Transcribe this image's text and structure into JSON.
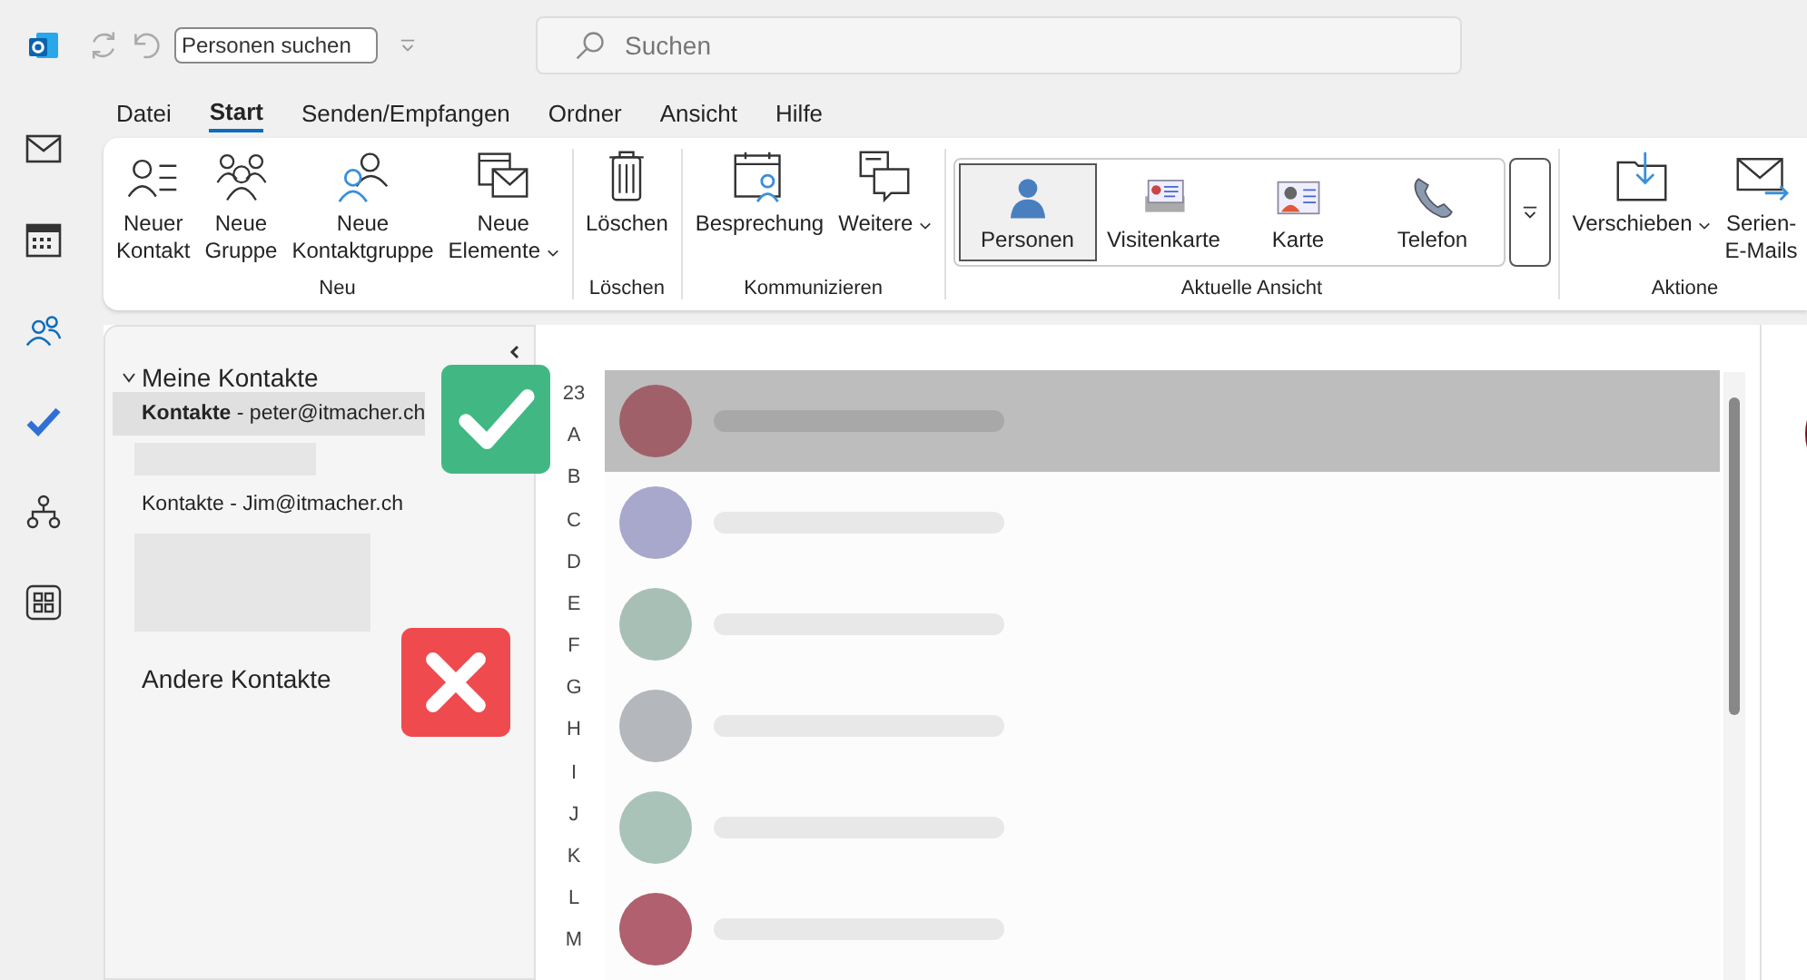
{
  "app_bar": {
    "people_search": "Personen suchen",
    "search": {
      "placeholder": "Suchen"
    }
  },
  "tabs": [
    {
      "label": "Datei",
      "selected": false
    },
    {
      "label": "Start",
      "selected": true
    },
    {
      "label": "Senden/Empfangen",
      "selected": false
    },
    {
      "label": "Ordner",
      "selected": false
    },
    {
      "label": "Ansicht",
      "selected": false
    },
    {
      "label": "Hilfe",
      "selected": false
    }
  ],
  "ribbon": {
    "groups": [
      {
        "label": "Neu",
        "buttons": [
          {
            "kind": "large",
            "label": "Neuer\nKontakt",
            "dropdown": false
          },
          {
            "kind": "large",
            "label": "Neue\nGruppe",
            "dropdown": false
          },
          {
            "kind": "large",
            "label": "Neue\nKontaktgruppe",
            "dropdown": false
          },
          {
            "kind": "large",
            "label": "Neue\nElemente",
            "dropdown": true
          }
        ]
      },
      {
        "label": "Löschen",
        "buttons": [
          {
            "kind": "large",
            "label": "Löschen",
            "dropdown": false
          }
        ]
      },
      {
        "label": "Kommunizieren",
        "buttons": [
          {
            "kind": "large",
            "label": "Besprechung",
            "dropdown": false
          },
          {
            "kind": "large",
            "label": "Weitere",
            "dropdown": true
          }
        ]
      },
      {
        "label": "Aktuelle Ansicht",
        "buttons": [
          {
            "kind": "view",
            "label": "Personen",
            "selected": true
          },
          {
            "kind": "view",
            "label": "Visitenkarte",
            "selected": false
          },
          {
            "kind": "view",
            "label": "Karte",
            "selected": false
          },
          {
            "kind": "view",
            "label": "Telefon",
            "selected": false
          },
          {
            "kind": "more"
          }
        ]
      },
      {
        "label": "Aktione",
        "buttons": [
          {
            "kind": "large",
            "label": "Verschieben",
            "dropdown": true
          },
          {
            "kind": "large",
            "label": "Serien-\nE-Mails",
            "dropdown": false
          }
        ]
      }
    ]
  },
  "folders": {
    "title": "Meine Kontakte",
    "expanded": true,
    "items": [
      {
        "kind": "account",
        "label": "**Kontakte** - peter@itmacher.ch",
        "selected": true
      },
      {
        "kind": "blurred"
      },
      {
        "kind": "account",
        "label": "Kontakte - Jim@itmacher.ch",
        "selected": false
      },
      {
        "kind": "blurred"
      }
    ],
    "other": "Andere Kontakte"
  },
  "contacts": {
    "index": [
      "23",
      "A",
      "B",
      "C",
      "D",
      "E",
      "F",
      "G",
      "H",
      "I",
      "J",
      "K",
      "L",
      "M"
    ],
    "rows": [
      {
        "selected": true,
        "color": "#a0606a"
      },
      {
        "selected": false,
        "color": "#a8a8cc"
      },
      {
        "selected": false,
        "color": "#a8bfb6"
      },
      {
        "selected": false,
        "color": "#b4b8bc"
      },
      {
        "selected": false,
        "color": "#a9c3b9"
      },
      {
        "selected": false,
        "color": "#b0606e"
      }
    ]
  }
}
